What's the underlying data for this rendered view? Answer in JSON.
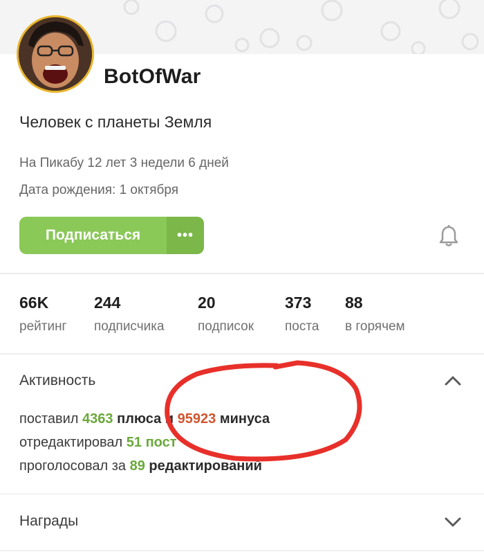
{
  "profile": {
    "username": "BotOfWar",
    "status": "Человек с планеты Земля",
    "on_site": "На Пикабу 12 лет 3 недели 6 дней",
    "birthday": "Дата рождения: 1 октября",
    "avatar_border_color": "#e8b52c"
  },
  "actions": {
    "subscribe_label": "Подписаться",
    "more_label": "•••",
    "subscribe_color": "#8ac858",
    "bell_icon": "bell-icon"
  },
  "stats": [
    {
      "value": "66K",
      "label": "рейтинг"
    },
    {
      "value": "244",
      "label": "подписчика"
    },
    {
      "value": "20",
      "label": "подписок"
    },
    {
      "value": "373",
      "label": "поста"
    },
    {
      "value": "88",
      "label": "в горячем"
    }
  ],
  "activity": {
    "title": "Активность",
    "line1": {
      "prefix": "поставил",
      "plus_count": "4363",
      "plus_word": "плюса и",
      "minus_count": "95923",
      "minus_word": "минуса"
    },
    "line2": {
      "prefix": "отредактировал",
      "count": "51",
      "word": "пост"
    },
    "line3": {
      "prefix": "проголосовал за",
      "count": "89",
      "word": "редактирований"
    },
    "expanded": true
  },
  "awards": {
    "title": "Награды",
    "expanded": false
  },
  "colors": {
    "accent_green": "#6aa83a",
    "minus_red": "#d1542e",
    "annotation_red": "#e8302a"
  }
}
